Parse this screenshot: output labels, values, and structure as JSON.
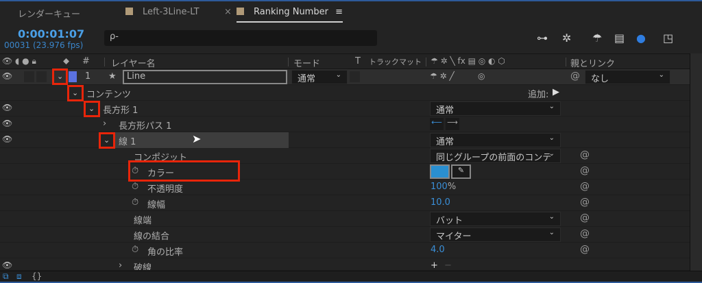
{
  "tabs": [
    {
      "label": "レンダーキュー"
    },
    {
      "label": "Left-3Line-LT"
    },
    {
      "label": "Ranking Number",
      "close": "×",
      "menu": "≡"
    }
  ],
  "timecode": "0:00:01:07",
  "frame_info": "00031 (23.976 fps)",
  "search": {
    "icon": "ρ-"
  },
  "headers": {
    "layer_name": "レイヤー名",
    "mode": "モード",
    "t": "T",
    "track_matte": "トラックマット",
    "parent": "親とリンク",
    "num": "#"
  },
  "layer": {
    "index": "1",
    "name": "Line",
    "mode": "通常",
    "parent": "なし",
    "label_color": "#5b72e0"
  },
  "contents": {
    "label": "コンテンツ",
    "add": "追加:"
  },
  "rect": {
    "label": "長方形 1",
    "mode": "通常"
  },
  "rect_path": {
    "label": "長方形パス 1"
  },
  "stroke": {
    "label": "線 1",
    "mode": "通常"
  },
  "props": {
    "composite": {
      "label": "コンポジット",
      "value": "同じグループの前面のコンテ"
    },
    "color": {
      "label": "カラー",
      "swatch": "#2a8fd0"
    },
    "opacity": {
      "label": "不透明度",
      "value": "100",
      "unit": "%"
    },
    "width": {
      "label": "線幅",
      "value": "10.0"
    },
    "cap": {
      "label": "線端",
      "value": "バット"
    },
    "join": {
      "label": "線の結合",
      "value": "マイター"
    },
    "miter": {
      "label": "角の比率",
      "value": "4.0"
    },
    "dash": {
      "label": "破線"
    }
  }
}
